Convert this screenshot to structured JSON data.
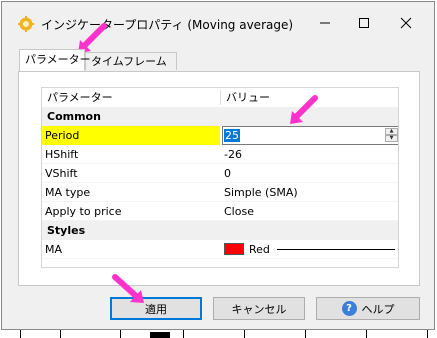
{
  "window": {
    "title": "インジケータープロパティ (Moving average)"
  },
  "tabs": [
    {
      "label": "パラメーター"
    },
    {
      "label": "タイムフレーム"
    }
  ],
  "grid": {
    "header": {
      "param": "パラメーター",
      "value": "バリュー"
    },
    "categories": {
      "common": "Common",
      "styles": "Styles"
    },
    "rows": [
      {
        "label": "Period",
        "value": "25"
      },
      {
        "label": "HShift",
        "value": "-26"
      },
      {
        "label": "VShift",
        "value": "0"
      },
      {
        "label": "MA type",
        "value": "Simple (SMA)"
      },
      {
        "label": "Apply to price",
        "value": "Close"
      }
    ],
    "style_row": {
      "label": "MA",
      "color_name": "Red",
      "color": "#ff0000"
    }
  },
  "buttons": {
    "apply": "適用",
    "cancel": "キャンセル",
    "help": "ヘルプ"
  },
  "colors": {
    "highlight": "#ffff00",
    "annotation_arrow": "#ff33cc",
    "selection": "#0078d7"
  }
}
